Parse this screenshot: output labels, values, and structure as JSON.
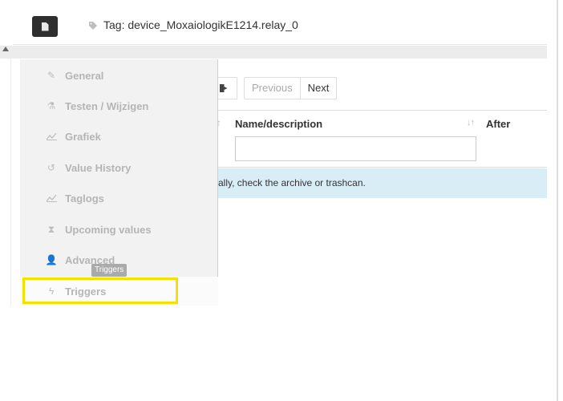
{
  "header": {
    "title": "Tag: device_MoxaiologikE1214.relay_0"
  },
  "toolbar": {
    "previous_label": "Previous",
    "next_label": "Next"
  },
  "table": {
    "columns": [
      "Name/description",
      "After"
    ],
    "sort_icon": "sort-icon",
    "info_message": "ally, check the archive or trashcan."
  },
  "menu": {
    "items": [
      {
        "label": "General",
        "icon": "pencil-icon"
      },
      {
        "label": "Testen / Wijzigen",
        "icon": "flask-icon"
      },
      {
        "label": "Grafiek",
        "icon": "line-chart-icon"
      },
      {
        "label": "Value History",
        "icon": "history-icon"
      },
      {
        "label": "Taglogs",
        "icon": "line-chart-icon"
      },
      {
        "label": "Upcoming values",
        "icon": "hourglass-icon"
      },
      {
        "label": "Advanced",
        "icon": "user-plus-icon"
      },
      {
        "label": "Triggers",
        "icon": "bolt-icon"
      }
    ],
    "tooltip": "Triggers",
    "highlight_color": "#f5e100"
  },
  "colors": {
    "info_background": "#d9edf7",
    "menu_background": "#f2f2f2",
    "header_button": "#2f2f2f"
  }
}
